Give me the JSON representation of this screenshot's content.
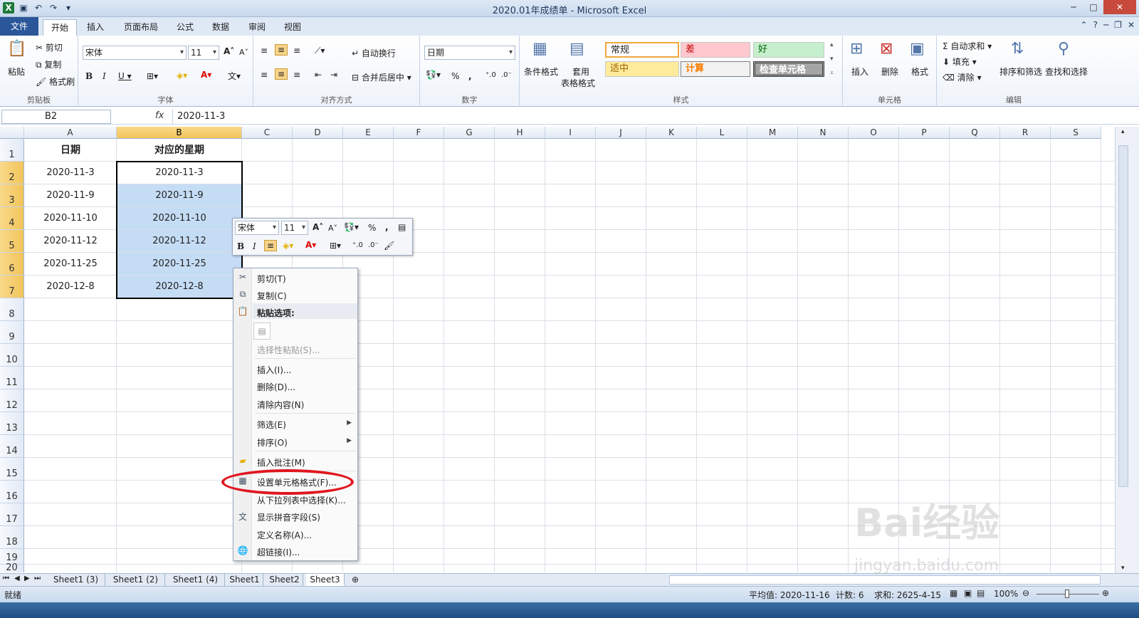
{
  "window": {
    "title": "2020.01年成绩单 - Microsoft Excel"
  },
  "tabs": [
    {
      "label": "文件"
    },
    {
      "label": "开始"
    },
    {
      "label": "插入"
    },
    {
      "label": "页面布局"
    },
    {
      "label": "公式"
    },
    {
      "label": "数据"
    },
    {
      "label": "审阅"
    },
    {
      "label": "视图"
    }
  ],
  "ribbon": {
    "clipboard": {
      "label": "剪贴板",
      "paste": "粘贴",
      "cut": "剪切",
      "copy": "复制",
      "painter": "格式刷"
    },
    "font": {
      "label": "字体",
      "name": "宋体",
      "size": "11"
    },
    "align": {
      "label": "对齐方式",
      "wrap": "自动换行",
      "merge": "合并后居中"
    },
    "number": {
      "label": "数字",
      "format": "日期"
    },
    "styles": {
      "label": "样式",
      "cond": "条件格式",
      "table1": "套用",
      "table2": "表格格式",
      "normal": "常规",
      "bad": "差",
      "good": "好",
      "neutral": "适中",
      "calc": "计算",
      "check": "检查单元格"
    },
    "cells": {
      "label": "单元格",
      "insert": "插入",
      "delete": "删除",
      "format": "格式"
    },
    "editing": {
      "label": "编辑",
      "autosum": "自动求和",
      "fill": "填充",
      "clear": "清除",
      "sort": "排序和筛选",
      "find": "查找和选择"
    }
  },
  "formula": {
    "namebox": "B2",
    "fx": "fx",
    "value": "2020-11-3"
  },
  "columns": [
    "A",
    "B",
    "C",
    "D",
    "E",
    "F",
    "G",
    "H",
    "I",
    "J",
    "K",
    "L",
    "M",
    "N",
    "O",
    "P",
    "Q",
    "R",
    "S"
  ],
  "rows": [
    "1",
    "2",
    "3",
    "4",
    "5",
    "6",
    "7",
    "8",
    "9",
    "10",
    "11",
    "12",
    "13",
    "14",
    "15",
    "16",
    "17",
    "18",
    "19",
    "20"
  ],
  "cells": {
    "a1": "日期",
    "b1": "对应的星期",
    "a": [
      "2020-11-3",
      "2020-11-9",
      "2020-11-10",
      "2020-11-12",
      "2020-11-25",
      "2020-12-8"
    ],
    "b": [
      "2020-11-3",
      "2020-11-9",
      "2020-11-10",
      "2020-11-12",
      "2020-11-25",
      "2020-12-8"
    ]
  },
  "minibar": {
    "font": "宋体",
    "size": "11"
  },
  "context_menu": {
    "cut": "剪切(T)",
    "copy": "复制(C)",
    "paste_options": "粘贴选项:",
    "paste_special": "选择性粘贴(S)...",
    "insert": "插入(I)...",
    "delete": "删除(D)...",
    "clear": "清除内容(N)",
    "filter": "筛选(E)",
    "sort": "排序(O)",
    "comment": "插入批注(M)",
    "format_cells": "设置单元格格式(F)...",
    "pick_list": "从下拉列表中选择(K)...",
    "phonetic": "显示拼音字段(S)",
    "define_name": "定义名称(A)...",
    "hyperlink": "超链接(I)..."
  },
  "sheets": [
    "Sheet1 (3)",
    "Sheet1 (2)",
    "Sheet1 (4)",
    "Sheet1",
    "Sheet2",
    "Sheet3"
  ],
  "status": {
    "ready": "就绪",
    "average": "平均值: 2020-11-16",
    "count": "计数: 6",
    "sum": "求和: 2625-4-15",
    "zoom": "100%"
  },
  "watermark": {
    "main": "Bai经验",
    "url": "jingyan.baidu.com"
  }
}
